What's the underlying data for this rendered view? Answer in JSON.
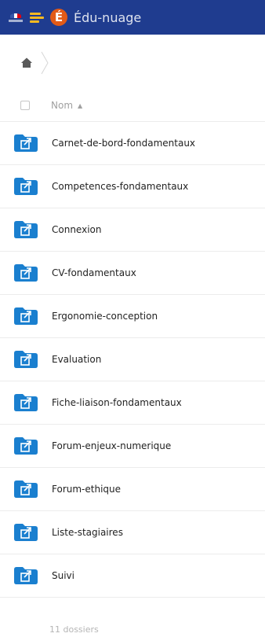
{
  "header": {
    "app_title": "Édu-nuage",
    "logo_letter": "É",
    "brand_color": "#1f3c8f",
    "logo_color": "#e25a17"
  },
  "breadcrumb": {
    "home_icon": "home-icon"
  },
  "list_header": {
    "name_column": "Nom",
    "sort_indicator": "▲"
  },
  "folders": [
    {
      "name": "Carnet-de-bord-fondamentaux",
      "icon": "shared-link-folder-icon"
    },
    {
      "name": "Competences-fondamentaux",
      "icon": "shared-link-folder-icon"
    },
    {
      "name": "Connexion",
      "icon": "shared-link-folder-icon"
    },
    {
      "name": "CV-fondamentaux",
      "icon": "shared-link-folder-icon"
    },
    {
      "name": "Ergonomie-conception",
      "icon": "shared-link-folder-icon"
    },
    {
      "name": "Evaluation",
      "icon": "shared-link-folder-icon"
    },
    {
      "name": "Fiche-liaison-fondamentaux",
      "icon": "shared-link-folder-icon"
    },
    {
      "name": "Forum-enjeux-numerique",
      "icon": "shared-link-folder-icon"
    },
    {
      "name": "Forum-ethique",
      "icon": "shared-link-folder-icon"
    },
    {
      "name": "Liste-stagiaires",
      "icon": "shared-link-folder-icon"
    },
    {
      "name": "Suivi",
      "icon": "shared-link-folder-icon"
    }
  ],
  "folder_color": "#1a7fcf",
  "summary": {
    "count_text": "11 dossiers"
  }
}
